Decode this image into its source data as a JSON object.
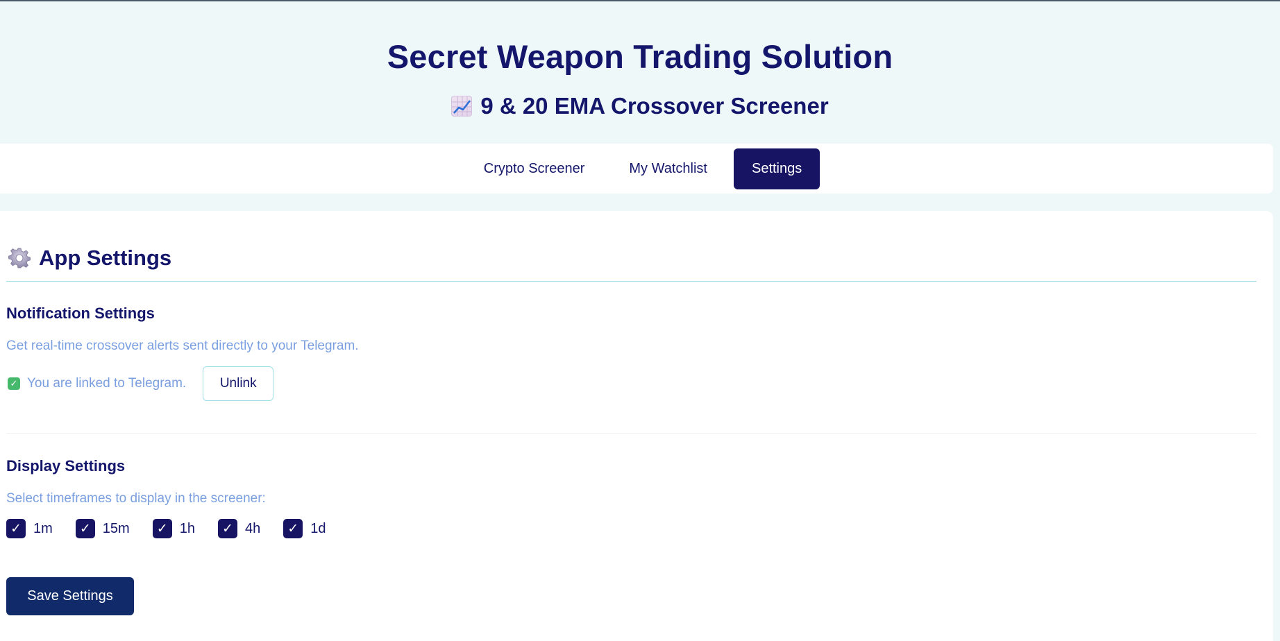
{
  "header": {
    "title": "Secret Weapon Trading Solution",
    "subtitle": "9 & 20 EMA Crossover Screener",
    "subtitle_icon": "chart-increasing-icon"
  },
  "nav": {
    "tabs": [
      {
        "label": "Crypto Screener",
        "active": false
      },
      {
        "label": "My Watchlist",
        "active": false
      },
      {
        "label": "Settings",
        "active": true
      }
    ]
  },
  "settings": {
    "title": "App Settings",
    "title_icon": "gear-icon",
    "notification": {
      "heading": "Notification Settings",
      "description": "Get real-time crossover alerts sent directly to your Telegram.",
      "status_icon": "check-mark-button-icon",
      "status_text": "You are linked to Telegram.",
      "unlink_label": "Unlink"
    },
    "display": {
      "heading": "Display Settings",
      "description": "Select timeframes to display in the screener:",
      "timeframes": [
        {
          "label": "1m",
          "checked": true
        },
        {
          "label": "15m",
          "checked": true
        },
        {
          "label": "1h",
          "checked": true
        },
        {
          "label": "4h",
          "checked": true
        },
        {
          "label": "1d",
          "checked": true
        }
      ]
    },
    "save_label": "Save Settings"
  },
  "colors": {
    "background": "#eef8f8",
    "primary": "#161463",
    "text": "#14166b",
    "muted": "#7a9fe0",
    "accent_border": "#9fe0e6",
    "save_button": "#102a6a"
  }
}
